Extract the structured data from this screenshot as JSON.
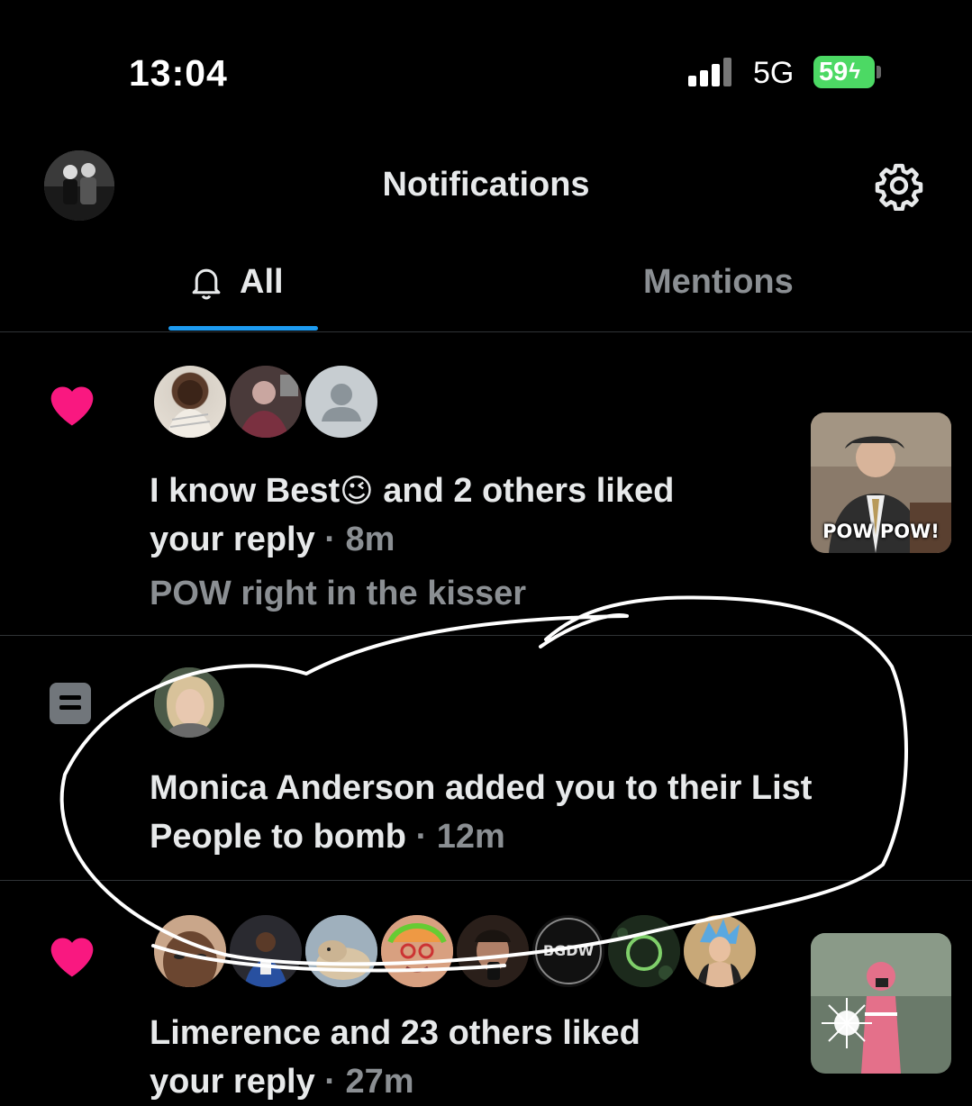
{
  "status_bar": {
    "time": "13:04",
    "network": "5G",
    "battery": "59"
  },
  "header": {
    "title": "Notifications"
  },
  "tabs": [
    {
      "label": "All"
    },
    {
      "label": "Mentions"
    }
  ],
  "notifications": [
    {
      "type": "like",
      "actor": "I know Best",
      "emoji": "😉",
      "action": "and 2 others liked",
      "line2": "your reply",
      "time": "· 8m",
      "snippet": "POW right in the kisser",
      "thumb_label": "POW POW!"
    },
    {
      "type": "list",
      "line1": "Monica Anderson added you to their List",
      "line2": "People to bomb",
      "time": "· 12m"
    },
    {
      "type": "like",
      "line1": "Limerence and 23 others liked",
      "line2": "your reply",
      "time": "· 27m",
      "avatar_badge": "BGDW"
    }
  ],
  "colors": {
    "accent": "#1d9bf0",
    "heart": "#f91880",
    "battery": "#4cd964"
  },
  "icons": [
    "gear-icon",
    "bell-icon",
    "heart-icon",
    "list-icon",
    "signal-icon",
    "battery-icon"
  ]
}
